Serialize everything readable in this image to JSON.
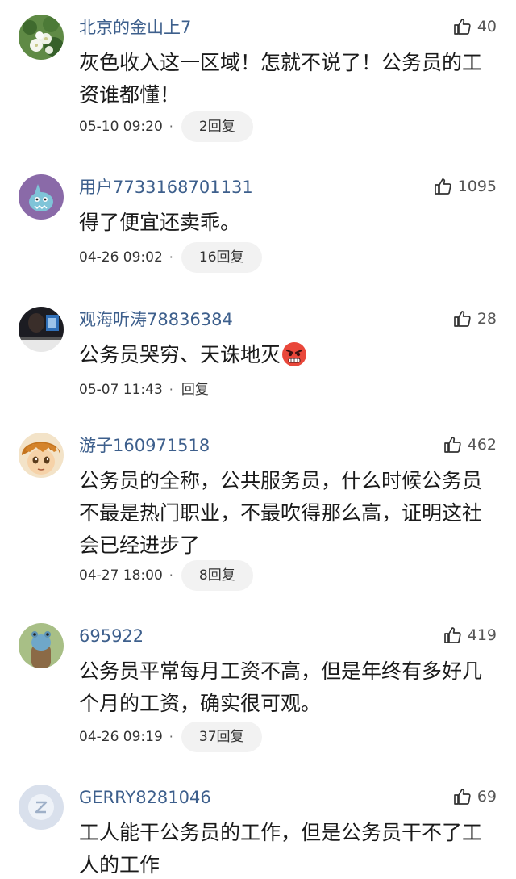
{
  "comments": [
    {
      "username": "北京的金山上7",
      "likes": "40",
      "text": "灰色收入这一区域！怎就不说了！公务员的工资谁都懂！",
      "time": "05-10 09:20",
      "replies": "2回复"
    },
    {
      "username": "用户7733168701131",
      "likes": "1095",
      "text": "得了便宜还卖乖。",
      "time": "04-26 09:02",
      "replies": "16回复"
    },
    {
      "username": "观海听涛78836384",
      "likes": "28",
      "text": "公务员哭穷、天诛地灭",
      "time": "05-07 11:43",
      "replies": "回复"
    },
    {
      "username": "游子160971518",
      "likes": "462",
      "text": "公务员的全称，公共服务员，什么时候公务员不最是热门职业，不最吹得那么高，证明这社会已经进步了",
      "time": "04-27 18:00",
      "replies": "8回复"
    },
    {
      "username": "695922",
      "likes": "419",
      "text": "公务员平常每月工资不高，但是年终有多好几个月的工资，确实很可观。",
      "time": "04-26 09:19",
      "replies": "37回复"
    },
    {
      "username": "GERRY8281046",
      "likes": "69",
      "text": "工人能干公务员的工作，但是公务员干不了工人的工作",
      "time": "",
      "replies": ""
    }
  ],
  "icons": {
    "like": "thumbs-up-icon",
    "emoji": "angry-face-emoji-icon"
  },
  "colors": {
    "username": "#3d5f8c",
    "text": "#1a1a1a",
    "pill_bg": "#f2f2f2"
  }
}
